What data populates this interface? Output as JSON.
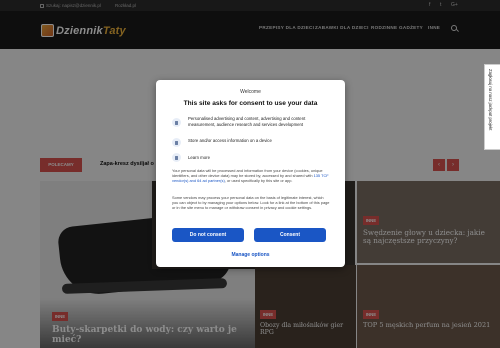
{
  "topbar": {
    "email": "Szukaj: napisz@dziennik.pl",
    "about": "Rozkład.pl",
    "social": [
      "f",
      "t",
      "G+"
    ]
  },
  "header": {
    "logo_part1": "Dziennik",
    "logo_part2": "Taty",
    "nav": [
      "PRZEPISY DLA DZIECI",
      "ZABAWKI DLA DZIECI",
      "RODZINNE GADŻETY",
      "INNE"
    ]
  },
  "side_tab": "Zagłosuj na nasz jackpot projekt",
  "trending": {
    "label": "POLECAMY",
    "text": "Zapa-kresz dysiljał o",
    "prev": "‹",
    "next": "›"
  },
  "cards": [
    {
      "badge": "INNE",
      "title": "Buty-skarpetki do wody: czy warto je mieć?"
    },
    {
      "badge": "INNE",
      "title": "Swędzenie głowy u dziecka: jakie są najczęstsze przyczyny?"
    },
    {
      "badge": "INNE",
      "title": "Obozy dla miłośników gier RPG"
    },
    {
      "badge": "INNE",
      "title": "TOP 5 męskich perfum na jesień 2021"
    }
  ],
  "consent": {
    "welcome": "Welcome",
    "title": "This site asks for consent to use your data",
    "purposes": [
      "Personalised advertising and content, advertising and content measurement, audience research and services development",
      "Store and/or access information on a device"
    ],
    "learn_more": "Learn more",
    "body1_pre": "Your personal data will be processed and information from your device (cookies, unique identifiers, and other device data) may be stored by, accessed by and shared with ",
    "body1_link": "135 TCF vendor(s) and 64 ad partner(s)",
    "body1_post": ", or used specifically by this site or app.",
    "body2": "Some vendors may process your personal data on the basis of legitimate interest, which you can object to by managing your options below. Look for a link at the bottom of this page or in the site menu to manage or withdraw consent in privacy and cookie settings.",
    "do_not_consent": "Do not consent",
    "consent": "Consent",
    "manage_options": "Manage options"
  },
  "colors": {
    "accent": "#d9534f",
    "consent_blue": "#1a56c5",
    "header_bg": "#1a1a1a"
  }
}
